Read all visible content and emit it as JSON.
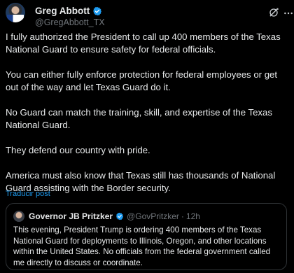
{
  "author": {
    "display_name": "Greg Abbott",
    "handle": "@GregAbbott_TX",
    "verified_color": "#1d9bf0"
  },
  "icons": {
    "avatar": "avatar",
    "verified": "verified-badge-icon",
    "grok": "grok-icon",
    "more": "more-options-icon"
  },
  "tweet": {
    "paragraphs": [
      "I fully authorized the President to call up 400 members of the Texas National Guard to ensure safety for federal officials.",
      "You can either fully enforce protection for federal employees or get out of the way and let Texas Guard do it.",
      "No Guard can match the training, skill, and expertise of the Texas National Guard.",
      "They defend our country with pride.",
      "America must also know that Texas still has thousands of National Guard assisting with the Border security."
    ],
    "translate_label": "Traducir post"
  },
  "quote": {
    "display_name": "Governor JB Pritzker",
    "handle": "@GovPritzker",
    "separator": "·",
    "time": "12h",
    "text": "This evening, President Trump is ordering 400 members of the Texas National Guard for deployments to Illinois, Oregon, and other locations within the United States. No officials from the federal government called me directly to discuss or coordinate."
  },
  "colors": {
    "background": "#000000",
    "text": "#e7e9ea",
    "secondary": "#71767b",
    "accent": "#1d9bf0",
    "border": "#2f3336"
  }
}
